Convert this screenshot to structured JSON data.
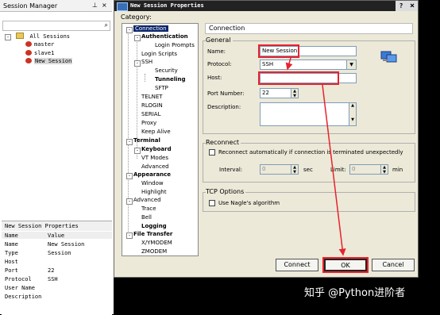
{
  "session_manager": {
    "title": "Session Manager",
    "toolbar_icons": [
      "pin-icon",
      "close-icon"
    ],
    "tree": {
      "root": "All Sessions",
      "items": [
        "master",
        "slave1",
        "New Session"
      ],
      "selected": "New Session"
    },
    "properties": {
      "title": "New Session Properties",
      "col_name": "Name",
      "col_value": "Value",
      "rows": [
        {
          "name": "Name",
          "value": "New Session"
        },
        {
          "name": "Type",
          "value": "Session"
        },
        {
          "name": "Host",
          "value": ""
        },
        {
          "name": "Port",
          "value": "22"
        },
        {
          "name": "Protocol",
          "value": "SSH"
        },
        {
          "name": "User Name",
          "value": ""
        },
        {
          "name": "Description",
          "value": ""
        }
      ]
    }
  },
  "dialog": {
    "title": "New Session Properties",
    "help": "?",
    "close": "×",
    "category_label": "Category:",
    "categories": [
      {
        "label": "Connection",
        "selected": true
      },
      {
        "label": "Authentication",
        "bold": true
      },
      {
        "label": "Login Prompts"
      },
      {
        "label": "Login Scripts"
      },
      {
        "label": "SSH"
      },
      {
        "label": "Security"
      },
      {
        "label": "Tunneling",
        "bold": true
      },
      {
        "label": "SFTP"
      },
      {
        "label": "TELNET"
      },
      {
        "label": "RLOGIN"
      },
      {
        "label": "SERIAL"
      },
      {
        "label": "Proxy"
      },
      {
        "label": "Keep Alive"
      },
      {
        "label": "Terminal",
        "bold": true
      },
      {
        "label": "Keyboard",
        "bold": true
      },
      {
        "label": "VT Modes"
      },
      {
        "label": "Advanced"
      },
      {
        "label": "Appearance",
        "bold": true
      },
      {
        "label": "Window"
      },
      {
        "label": "Highlight"
      },
      {
        "label": "Advanced"
      },
      {
        "label": "Trace"
      },
      {
        "label": "Bell"
      },
      {
        "label": "Logging",
        "bold": true
      },
      {
        "label": "File Transfer",
        "bold": true
      },
      {
        "label": "X/YMODEM"
      },
      {
        "label": "ZMODEM"
      }
    ],
    "section_header": "Connection",
    "general": {
      "label": "General",
      "name_label": "Name:",
      "name_value": "New Session",
      "protocol_label": "Protocol:",
      "protocol_value": "SSH",
      "host_label": "Host:",
      "host_value": "",
      "port_label": "Port Number:",
      "port_value": "22",
      "description_label": "Description:",
      "description_value": ""
    },
    "reconnect": {
      "label": "Reconnect",
      "auto_label": "Reconnect automatically if connection is terminated unexpectedly",
      "auto_checked": false,
      "interval_label": "Interval:",
      "interval_value": "0",
      "interval_unit": "sec",
      "limit_label": "Limit:",
      "limit_value": "0",
      "limit_unit": "min"
    },
    "tcp": {
      "label": "TCP Options",
      "nagle_label": "Use Nagle's algorithm",
      "nagle_checked": false
    },
    "buttons": {
      "connect": "Connect",
      "ok": "OK",
      "cancel": "Cancel"
    }
  },
  "annotation_color": "#e8222e",
  "watermark": "知乎 @Python进阶者"
}
